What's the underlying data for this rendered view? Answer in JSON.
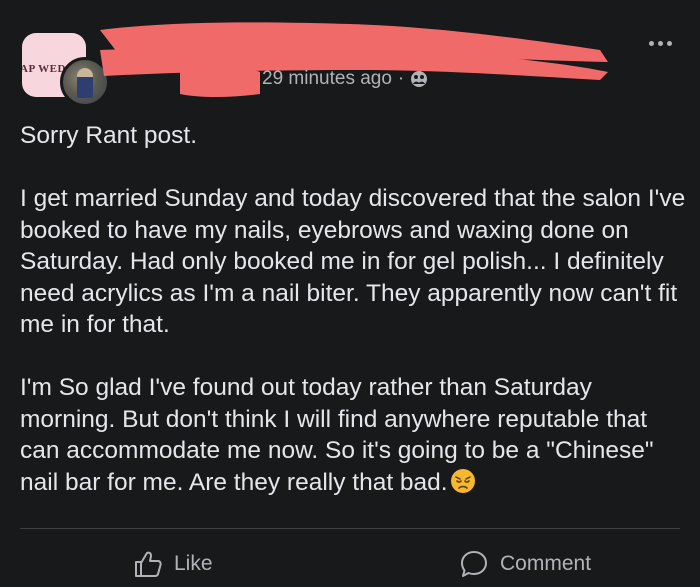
{
  "header": {
    "group_avatar_text": "AP WED",
    "timestamp": "29 minutes ago",
    "separator": "·",
    "audience_icon": "group-audience-icon",
    "redaction_color": "#f06a6a"
  },
  "post": {
    "paragraphs": [
      "Sorry Rant post.",
      "I get married Sunday and today discovered that the salon I've booked to have my nails, eyebrows and waxing done on Saturday. Had only booked me in for gel polish... I definitely need acrylics as I'm a nail biter. They apparently now can't fit me in for that.",
      "I'm So glad I've found out today rather than Saturday morning. But don't think I will find anywhere reputable that can accommodate me now. So it's going to be a \"Chinese\" nail bar for me. Are they really that bad."
    ],
    "trailing_emoji": "disappointed-face-emoji"
  },
  "actions": {
    "like_label": "Like",
    "comment_label": "Comment"
  },
  "colors": {
    "background": "#18191a",
    "text": "#e4e6eb",
    "muted": "#b0b3b8"
  }
}
